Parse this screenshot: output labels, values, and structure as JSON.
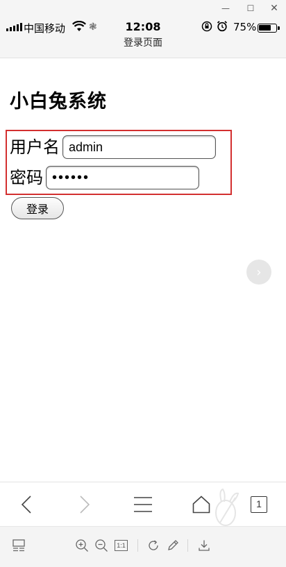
{
  "status_bar": {
    "carrier": "中国移动",
    "time": "12:08",
    "battery": "75%",
    "battery_level": 0.75
  },
  "page": {
    "title": "登录页面"
  },
  "app": {
    "system_title": "小白兔系统"
  },
  "login": {
    "username_label": "用户名",
    "username_value": "admin",
    "password_label": "密码",
    "password_value": "••••••",
    "submit_label": "登录"
  },
  "bottom_nav": {
    "tab_count": "1"
  },
  "toolbar": {
    "actual_size_label": "1:1"
  },
  "colors": {
    "highlight_border": "#d32f2f",
    "chrome_background": "#f5f5f5"
  }
}
